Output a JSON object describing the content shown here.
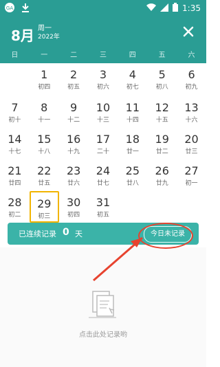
{
  "status": {
    "time": "1:35"
  },
  "header": {
    "month": "8月",
    "weekday": "周一",
    "year": "2022年"
  },
  "weekdays": [
    "日",
    "一",
    "二",
    "三",
    "四",
    "五",
    "六"
  ],
  "calendar": {
    "days": [
      {
        "day": "1",
        "lunar": "初四"
      },
      {
        "day": "2",
        "lunar": "初五"
      },
      {
        "day": "3",
        "lunar": "初六"
      },
      {
        "day": "4",
        "lunar": "初七"
      },
      {
        "day": "5",
        "lunar": "初八"
      },
      {
        "day": "6",
        "lunar": "初九"
      },
      {
        "day": "7",
        "lunar": "初十"
      },
      {
        "day": "8",
        "lunar": "十一"
      },
      {
        "day": "9",
        "lunar": "十二"
      },
      {
        "day": "10",
        "lunar": "十三"
      },
      {
        "day": "11",
        "lunar": "十四"
      },
      {
        "day": "12",
        "lunar": "十五"
      },
      {
        "day": "13",
        "lunar": "十六"
      },
      {
        "day": "14",
        "lunar": "十七"
      },
      {
        "day": "15",
        "lunar": "十八"
      },
      {
        "day": "16",
        "lunar": "十九"
      },
      {
        "day": "17",
        "lunar": "二十"
      },
      {
        "day": "18",
        "lunar": "廿一"
      },
      {
        "day": "19",
        "lunar": "廿二"
      },
      {
        "day": "20",
        "lunar": "廿三"
      },
      {
        "day": "21",
        "lunar": "廿四"
      },
      {
        "day": "22",
        "lunar": "廿五"
      },
      {
        "day": "23",
        "lunar": "廿六"
      },
      {
        "day": "24",
        "lunar": "廿七"
      },
      {
        "day": "25",
        "lunar": "廿八"
      },
      {
        "day": "26",
        "lunar": "廿九"
      },
      {
        "day": "27",
        "lunar": "初一"
      },
      {
        "day": "28",
        "lunar": "初二"
      },
      {
        "day": "29",
        "lunar": "初三"
      },
      {
        "day": "30",
        "lunar": "初四"
      },
      {
        "day": "31",
        "lunar": "初五"
      }
    ],
    "selected_day": "29"
  },
  "streak": {
    "label": "已连续记录",
    "count": "0",
    "unit": "天",
    "button": "今日未记录"
  },
  "empty_state": {
    "text": "点击此处记录哟"
  },
  "colors": {
    "primary": "#2a9d94",
    "selected_border": "#f2b400",
    "annotation_red": "#e7432f"
  }
}
